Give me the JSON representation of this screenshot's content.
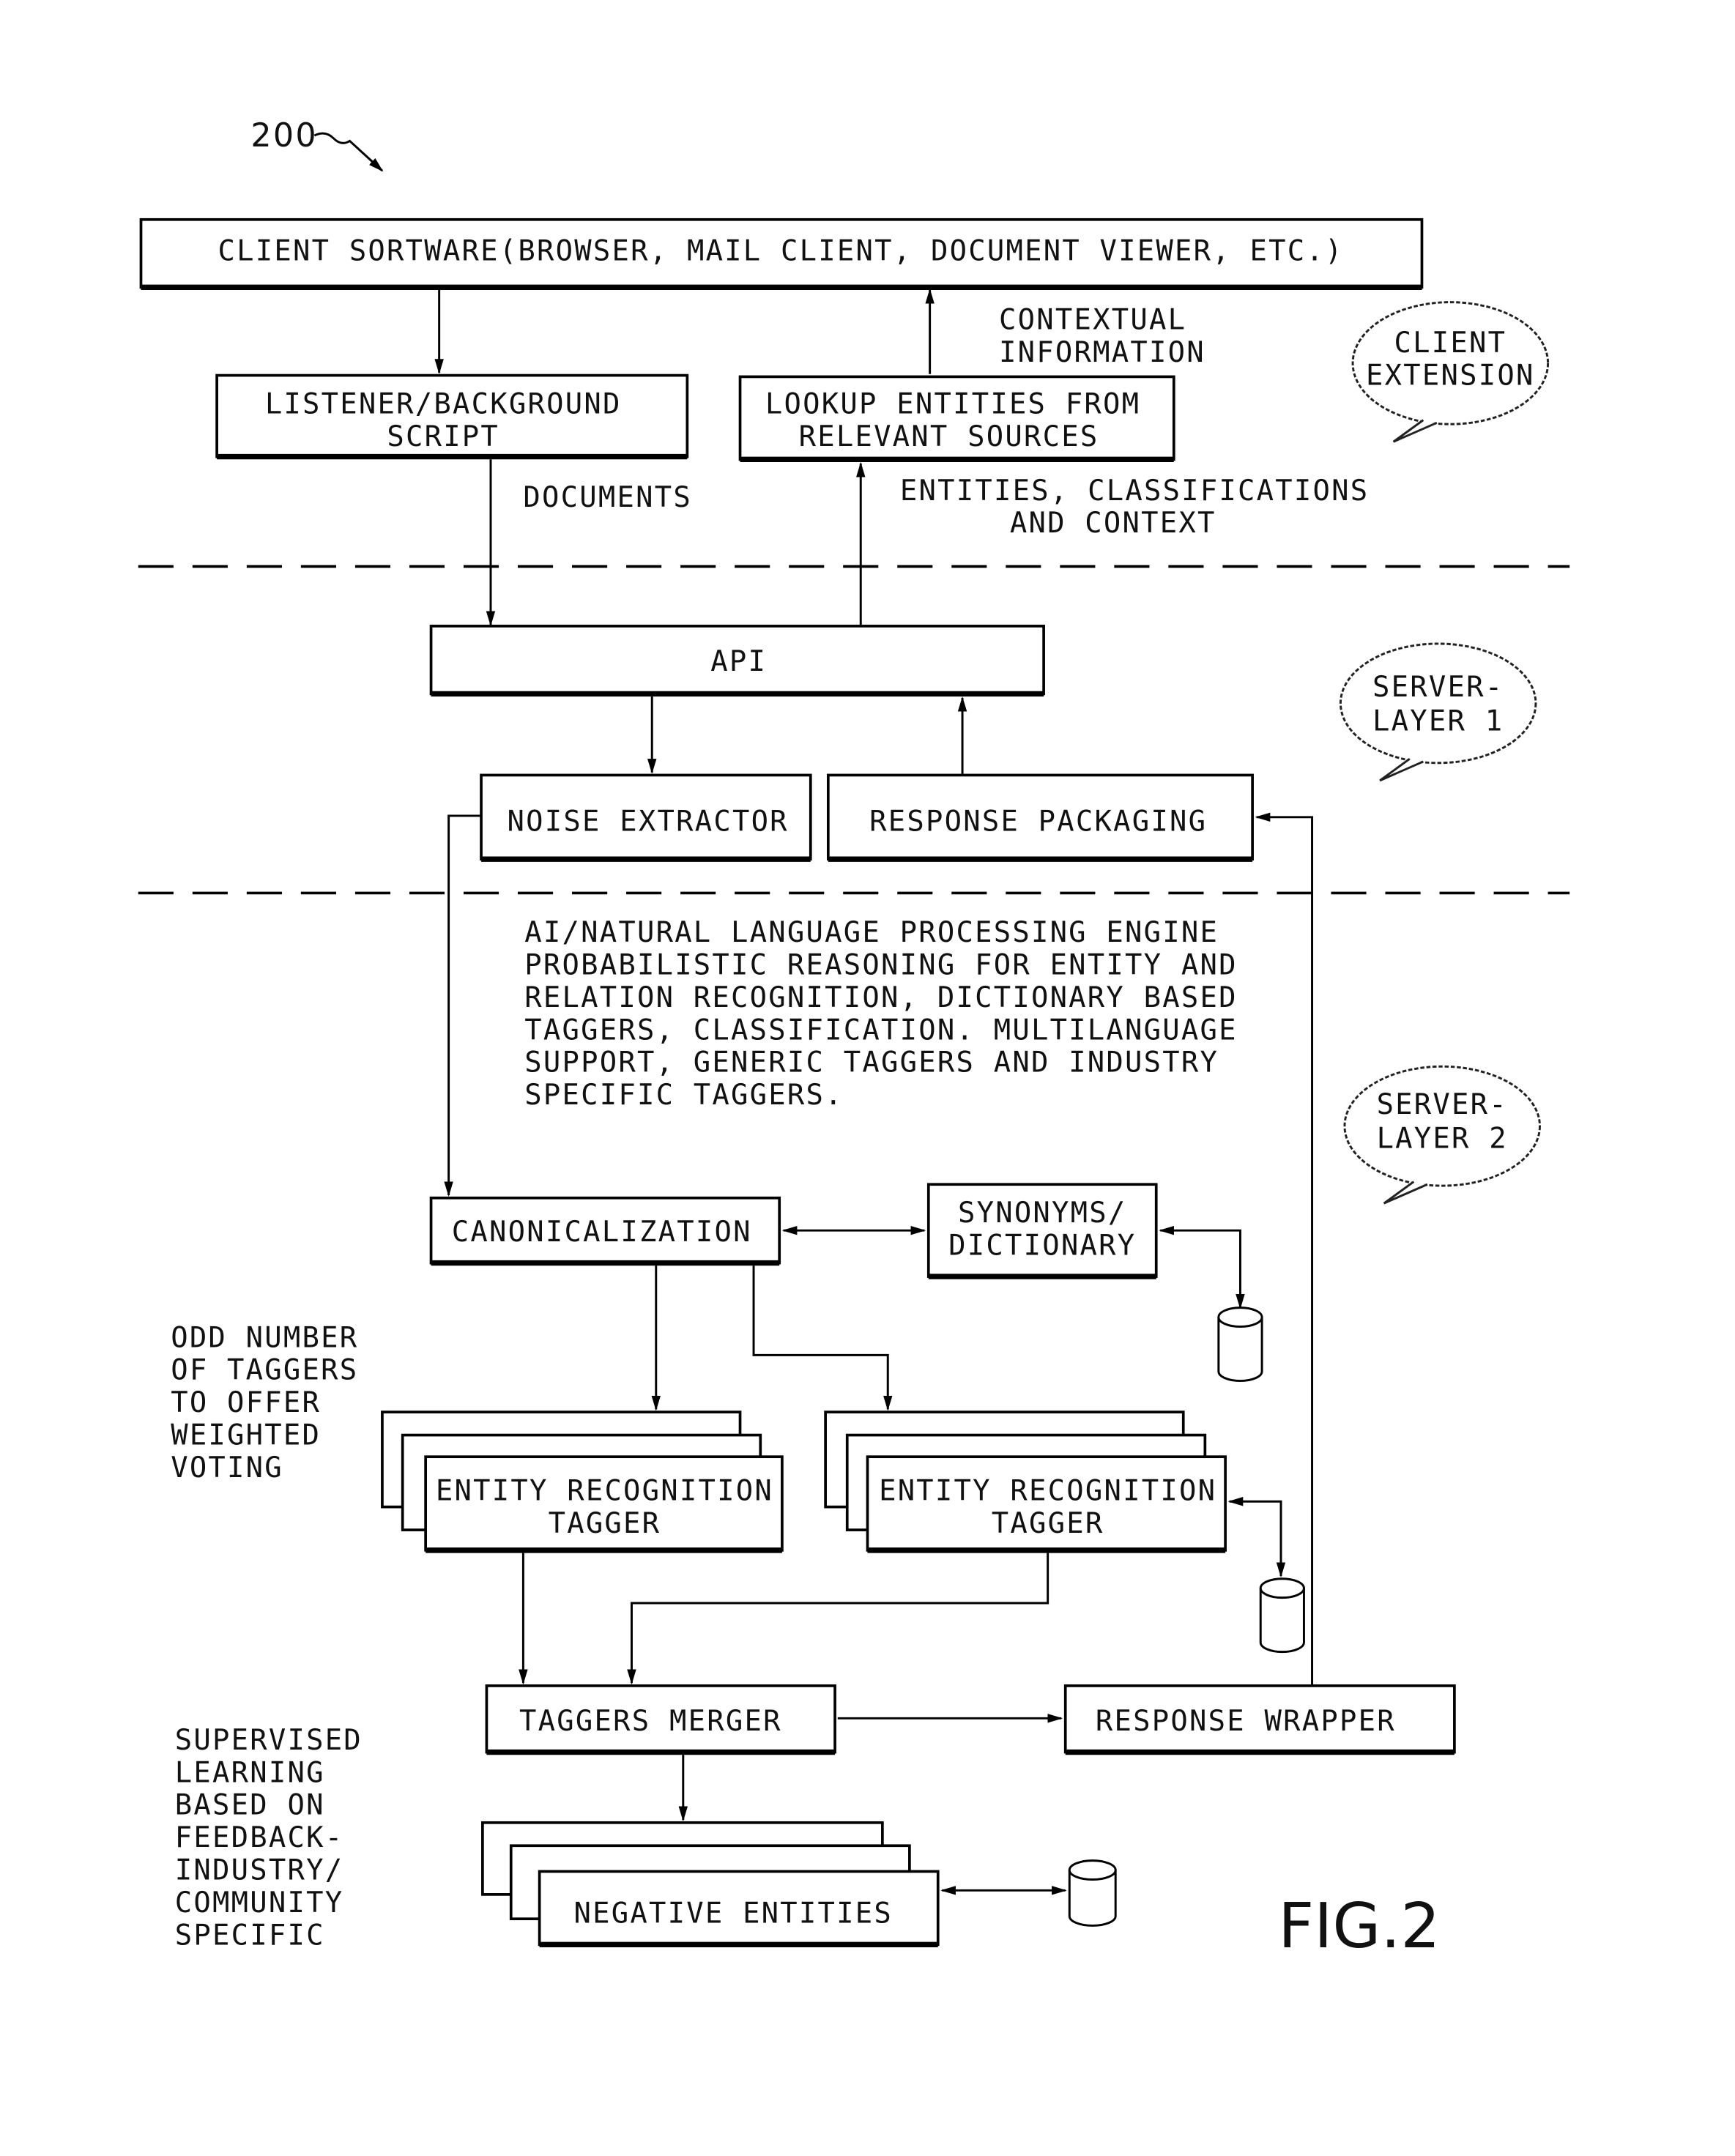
{
  "figure": {
    "reference_number": "200",
    "figure_label": "FIG.2"
  },
  "layers": {
    "client_extension": [
      "CLIENT",
      "EXTENSION"
    ],
    "server_layer_1": [
      "SERVER-",
      "LAYER  1"
    ],
    "server_layer_2": [
      "SERVER-",
      "LAYER  2"
    ]
  },
  "boxes": {
    "client_software": [
      "CLIENT  SORTWARE(BROWSER,  MAIL  CLIENT,  DOCUMENT  VIEWER,  ETC.)"
    ],
    "listener": [
      "LISTENER/BACKGROUND",
      "SCRIPT"
    ],
    "lookup": [
      "LOOKUP  ENTITIES  FROM",
      "RELEVANT  SOURCES"
    ],
    "api": [
      "API"
    ],
    "noise_extractor": [
      "NOISE  EXTRACTOR"
    ],
    "response_packaging": [
      "RESPONSE  PACKAGING"
    ],
    "canonicalization": [
      "CANONICALIZATION"
    ],
    "synonyms": [
      "SYNONYMS/",
      "DICTIONARY"
    ],
    "entity_tagger_left": [
      "ENTITY  RECOGNITION",
      "TAGGER"
    ],
    "entity_tagger_right": [
      "ENTITY  RECOGNITION",
      "TAGGER"
    ],
    "taggers_merger": [
      "TAGGERS  MERGER"
    ],
    "response_wrapper": [
      "RESPONSE  WRAPPER"
    ],
    "negative_entities": [
      "NEGATIVE  ENTITIES"
    ]
  },
  "edge_labels": {
    "contextual_information": [
      "CONTEXTUAL",
      "INFORMATION"
    ],
    "documents": [
      "DOCUMENTS"
    ],
    "entities_classifications": [
      "ENTITIES,  CLASSIFICATIONS",
      "AND  CONTEXT"
    ]
  },
  "annotations": {
    "nlp_engine": [
      "AI/NATURAL  LANGUAGE  PROCESSING  ENGINE",
      "PROBABILISTIC  REASONING  FOR  ENTITY  AND",
      "RELATION  RECOGNITION,  DICTIONARY  BASED",
      "TAGGERS,  CLASSIFICATION.  MULTILANGUAGE",
      "SUPPORT,  GENERIC  TAGGERS  AND  INDUSTRY",
      "SPECIFIC  TAGGERS."
    ],
    "odd_number": [
      "ODD  NUMBER",
      "OF  TAGGERS",
      "TO  OFFER",
      "WEIGHTED",
      "VOTING"
    ],
    "supervised": [
      "SUPERVISED",
      "LEARNING",
      "BASED  ON",
      "FEEDBACK-",
      "INDUSTRY/",
      "COMMUNITY",
      "SPECIFIC"
    ]
  }
}
